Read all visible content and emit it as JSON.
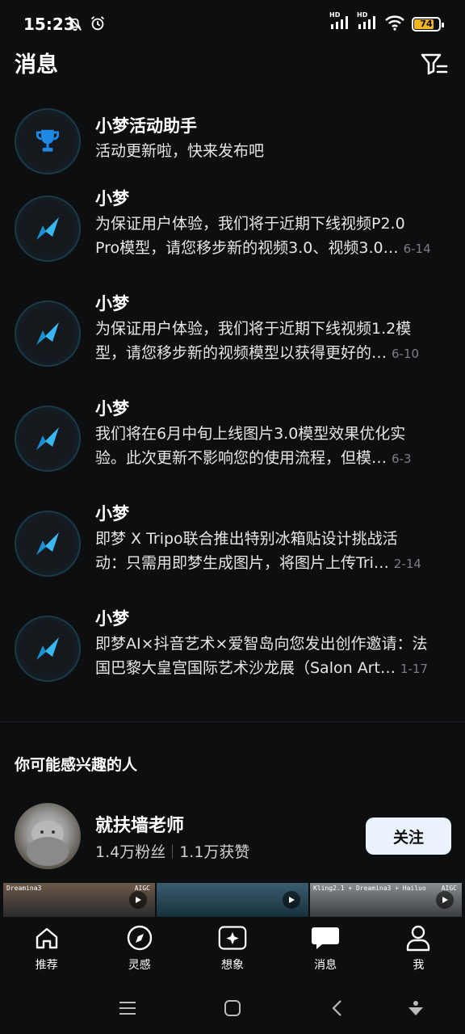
{
  "status": {
    "time": "15:23",
    "battery": "74",
    "net1": "HD",
    "net2": "HD"
  },
  "header": {
    "title": "消息"
  },
  "messages": [
    {
      "title": "小梦活动助手",
      "lines": [
        "活动更新啦，快来发布吧"
      ],
      "date": "",
      "icon": "trophy-icon"
    },
    {
      "title": "小梦",
      "lines": [
        "为保证用户体验，我们将于近期下线视频P2.0",
        "Pro模型，请您移步新的视频3.0、视频3.0…"
      ],
      "date": "6-14",
      "icon": "dreamina-logo-icon"
    },
    {
      "title": "小梦",
      "lines": [
        "为保证用户体验，我们将于近期下线视频1.2模",
        "型，请您移步新的视频模型以获得更好的…"
      ],
      "date": "6-10",
      "icon": "dreamina-logo-icon"
    },
    {
      "title": "小梦",
      "lines": [
        "我们将在6月中旬上线图片3.0模型效果优化实",
        "验。此次更新不影响您的使用流程，但模…"
      ],
      "date": "6-3",
      "icon": "dreamina-logo-icon"
    },
    {
      "title": "小梦",
      "lines": [
        "即梦 X Tripo联合推出特别冰箱贴设计挑战活",
        "动：只需用即梦生成图片，将图片上传Tri…"
      ],
      "date": "2-14",
      "icon": "dreamina-logo-icon"
    },
    {
      "title": "小梦",
      "lines": [
        "即梦AI×抖音艺术×爱智岛向您发出创作邀请：法",
        "国巴黎大皇宫国际艺术沙龙展（Salon Art…"
      ],
      "date": "1-17",
      "icon": "dreamina-logo-icon"
    }
  ],
  "suggested": {
    "section_title": "你可能感兴趣的人",
    "name": "就扶墙老师",
    "followers": "1.4万粉丝",
    "likes": "1.1万获赞",
    "follow_label": "关注",
    "thumbs": [
      {
        "label": "Dreamina3",
        "badge": "AIGC",
        "color": "#5a4a3a"
      },
      {
        "label": "",
        "badge": "",
        "color": "#2e4a5a"
      },
      {
        "label": "Kling2.1 + Dreamina3 + Hailuo",
        "badge": "AIGC",
        "color": "#6a6e72"
      }
    ]
  },
  "tabs": [
    {
      "label": "推荐",
      "icon": "home-icon"
    },
    {
      "label": "灵感",
      "icon": "compass-icon"
    },
    {
      "label": "想象",
      "icon": "sparkle-icon"
    },
    {
      "label": "消息",
      "icon": "message-icon"
    },
    {
      "label": "我",
      "icon": "profile-icon"
    }
  ]
}
